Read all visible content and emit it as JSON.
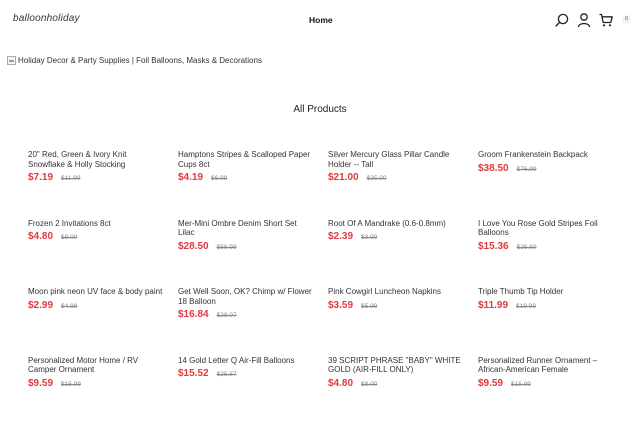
{
  "header": {
    "logo": "balloonholiday",
    "nav": {
      "home": "Home"
    },
    "icons": [
      "search-icon",
      "user-icon",
      "cart-icon"
    ],
    "cart_count": "0"
  },
  "banner": {
    "alt_text": "Holiday Decor & Party Supplies | Foil Balloons, Masks & Decorations"
  },
  "section": {
    "title": "All Products"
  },
  "colors": {
    "sale_price": "#e0393e",
    "original_price": "#888888"
  },
  "products": [
    {
      "name": "20\" Red, Green & Ivory Knit Snowflake & Holly Stocking",
      "sale_price": "$7.19",
      "original_price": "$11.99"
    },
    {
      "name": "Hamptons Stripes & Scalloped Paper Cups 8ct",
      "sale_price": "$4.19",
      "original_price": "$6.99"
    },
    {
      "name": "Silver Mercury Glass Pillar Candle Holder -- Tall",
      "sale_price": "$21.00",
      "original_price": "$35.00"
    },
    {
      "name": "Groom Frankenstein Backpack",
      "sale_price": "$38.50",
      "original_price": "$76.99"
    },
    {
      "name": "Frozen 2 Invitations 8ct",
      "sale_price": "$4.80",
      "original_price": "$8.00"
    },
    {
      "name": "Mer-Mini Ombre Denim Short Set Lilac",
      "sale_price": "$28.50",
      "original_price": "$56.99"
    },
    {
      "name": "Root Of A Mandrake (0.6-0.8mm)",
      "sale_price": "$2.39",
      "original_price": "$3.99"
    },
    {
      "name": "I Love You Rose Gold Stripes Foil Balloons",
      "sale_price": "$15.36",
      "original_price": "$25.60"
    },
    {
      "name": "Moon pink neon UV face & body paint",
      "sale_price": "$2.99",
      "original_price": "$4.99"
    },
    {
      "name": "Get Well Soon, OK? Chimp w/ Flower 18 Balloon",
      "sale_price": "$16.84",
      "original_price": "$28.07"
    },
    {
      "name": "Pink Cowgirl Luncheon Napkins",
      "sale_price": "$3.59",
      "original_price": "$5.99"
    },
    {
      "name": "Triple Thumb Tip Holder",
      "sale_price": "$11.99",
      "original_price": "$19.99"
    },
    {
      "name": "Personalized Motor Home / RV Camper Ornament",
      "sale_price": "$9.59",
      "original_price": "$15.99"
    },
    {
      "name": "14 Gold Letter Q Air-Fill Balloons",
      "sale_price": "$15.52",
      "original_price": "$25.87"
    },
    {
      "name": "39 SCRIPT PHRASE \"BABY\" WHITE GOLD (AIR-FILL ONLY)",
      "sale_price": "$4.80",
      "original_price": "$8.00"
    },
    {
      "name": "Personalized Runner Ornament – African-American Female",
      "sale_price": "$9.59",
      "original_price": "$15.99"
    }
  ]
}
